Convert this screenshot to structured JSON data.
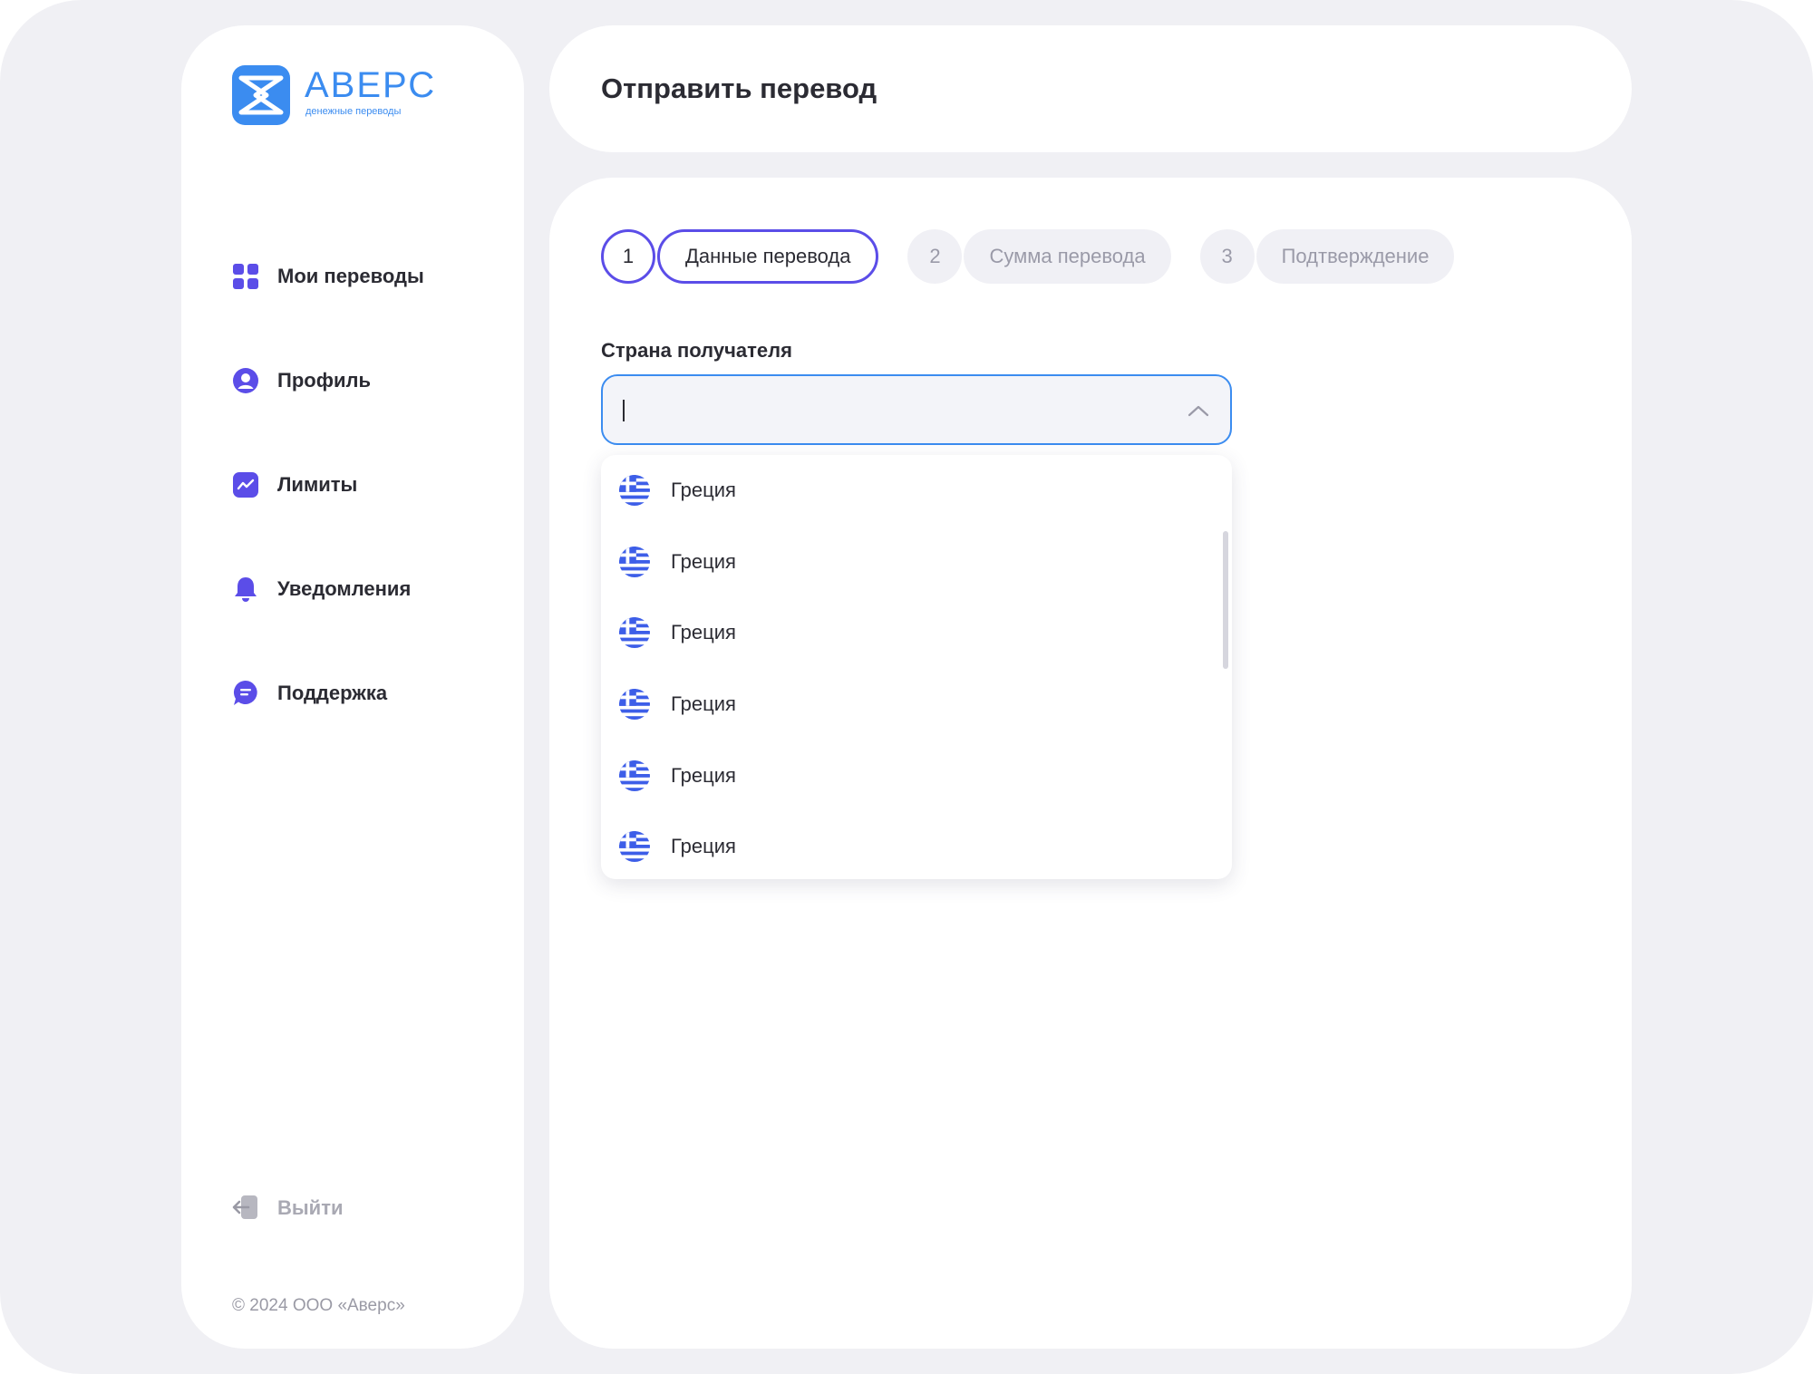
{
  "brand": {
    "name": "АВЕРС",
    "tagline": "денежные переводы",
    "logo_color": "#3b8cf0"
  },
  "sidebar": {
    "items": [
      {
        "label": "Мои переводы",
        "icon": "grid-icon"
      },
      {
        "label": "Профиль",
        "icon": "user-icon"
      },
      {
        "label": "Лимиты",
        "icon": "chart-icon"
      },
      {
        "label": "Уведомления",
        "icon": "bell-icon"
      },
      {
        "label": "Поддержка",
        "icon": "chat-icon"
      }
    ],
    "logout_label": "Выйти",
    "copyright": "© 2024 ООО «Аверс»"
  },
  "header": {
    "title": "Отправить перевод"
  },
  "steps": [
    {
      "number": "1",
      "label": "Данные перевода",
      "active": true
    },
    {
      "number": "2",
      "label": "Сумма перевода",
      "active": false
    },
    {
      "number": "3",
      "label": "Подтверждение",
      "active": false
    }
  ],
  "form": {
    "country_label": "Страна получателя",
    "country_value": ""
  },
  "dropdown": {
    "options": [
      "Греция",
      "Греция",
      "Греция",
      "Греция",
      "Греция",
      "Греция"
    ]
  },
  "colors": {
    "accent": "#5b4de8",
    "focus": "#3b8cf0",
    "background": "#f0f0f4",
    "muted": "#9a9aa8"
  }
}
